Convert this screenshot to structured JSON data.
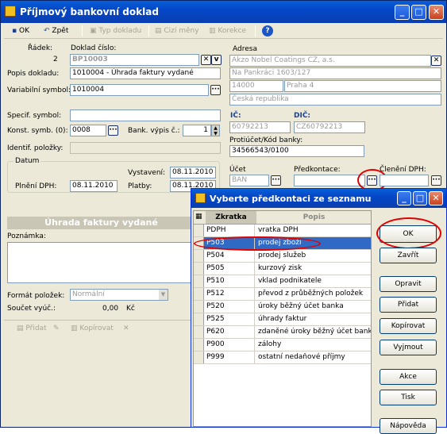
{
  "window": {
    "title": "Příjmový bankovní doklad"
  },
  "toolbar": {
    "ok": "OK",
    "back": "Zpět",
    "doc_type": "Typ dokladu",
    "currencies": "Cizí měny",
    "correction": "Korekce"
  },
  "form": {
    "row_label": "Řádek:",
    "row_value": "2",
    "docno_label": "Doklad číslo:",
    "docno_value": "BP10003",
    "desc_label": "Popis dokladu:",
    "desc_value": "1010004 - Úhrada faktury vydané",
    "varsym_label": "Variabilní symbol:",
    "varsym_value": "1010004",
    "specsym_label": "Specif. symbol:",
    "specsym_value": "",
    "constsym_label": "Konst. symb. (0):",
    "constsym_value": "0008",
    "bank_label": "Bank. výpis č.:",
    "bank_value": "1",
    "ident_label": "Identif. položky:",
    "ident_value": "",
    "date_group": "Datum",
    "issued_label": "Vystavení:",
    "issued_value": "08.11.2010",
    "vat_label": "Plnění DPH:",
    "vat_value": "08.11.2010",
    "pay_label": "Platby:",
    "pay_value": "08.11.2010",
    "address_label": "Adresa",
    "addr_name": "Akzo Nobel Coatings CZ, a.s.",
    "addr_street": "Na Pankráci 1603/127",
    "addr_zip": "14000",
    "addr_city": "Praha 4",
    "addr_country": "Česká republika",
    "ico_label": "IČ:",
    "ico_value": "60792213",
    "dic_label": "DIČ:",
    "dic_value": "CZ60792213",
    "account_label": "Protiúčet/Kód banky:",
    "account_value": "34566543/0100",
    "ucet_label": "Účet",
    "ucet_value": "BAN",
    "predkont_label": "Předkontace:",
    "predkont_value": "",
    "cleneni_label": "Členění DPH:",
    "cleneni_value": "",
    "banner": "Úhrada faktury vydané",
    "note_label": "Poznámka:",
    "format_label": "Formát položek:",
    "format_value": "Normální",
    "sum_label": "Součet vyúč.:",
    "sum_value": "0,00",
    "sum_cur": "Kč",
    "items_add": "Přidat",
    "items_copy": "Kopírovat"
  },
  "dialog": {
    "title": "Vyberte předkontaci ze seznamu",
    "col_code": "Zkratka",
    "col_desc": "Popis",
    "rows": [
      {
        "code": "PDPH",
        "desc": "vratka DPH"
      },
      {
        "code": "P503",
        "desc": "prodej zboží"
      },
      {
        "code": "P504",
        "desc": "prodej služeb"
      },
      {
        "code": "P505",
        "desc": "kurzový zisk"
      },
      {
        "code": "P510",
        "desc": "vklad podnikatele"
      },
      {
        "code": "P512",
        "desc": "převod z průběžných položek"
      },
      {
        "code": "P520",
        "desc": "úroky běžný účet banka"
      },
      {
        "code": "P525",
        "desc": "úhrady faktur"
      },
      {
        "code": "P620",
        "desc": "zdaněné úroky běžný účet banka"
      },
      {
        "code": "P900",
        "desc": "zálohy"
      },
      {
        "code": "P999",
        "desc": "ostatní nedaňové příjmy"
      }
    ],
    "buttons": {
      "ok": "OK",
      "close": "Zavřít",
      "edit": "Opravit",
      "add": "Přidat",
      "copy": "Kopírovat",
      "remove": "Vyjmout",
      "actions": "Akce",
      "print": "Tisk",
      "help": "Nápověda"
    }
  }
}
